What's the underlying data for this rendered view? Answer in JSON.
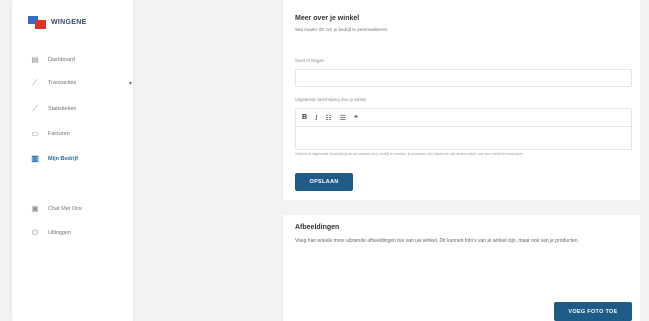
{
  "brand": {
    "name": "WINGENE"
  },
  "sidebar": {
    "items": [
      {
        "label": "Dashboard",
        "icon": "calendar-icon"
      },
      {
        "label": "Transacties",
        "icon": "chart-line-icon"
      },
      {
        "label": "Statistieken",
        "icon": "stats-icon"
      },
      {
        "label": "Facturen",
        "icon": "invoice-icon"
      },
      {
        "label": "Mijn Bedrijf",
        "icon": "store-icon"
      },
      {
        "label": "Chat Met Ons",
        "icon": "chat-icon"
      },
      {
        "label": "Uitloggen",
        "icon": "power-icon"
      }
    ]
  },
  "card1": {
    "title": "Meer over je winkel",
    "subtitle": "Wat maakt 'dit' om je bedrijf te personaliseren",
    "tags_label": "Soort of Slogan",
    "tags_value": "",
    "desc_label": "Uitgebreide beschrijving over je winkel",
    "toolbar": {
      "bold": "B",
      "italic": "I",
      "ul": "☷",
      "ol": "☰",
      "quote": "❝"
    },
    "help": "Gebruik de uitgebreide beschrijving om het verhaal van je bedrijf te vertellen, je producten of je klanten en alle andere zaken voor deze winkel te beschrijven.",
    "save_button": "OPSLAAN"
  },
  "card2": {
    "title": "Afbeeldingen",
    "body": "Voeg hier enkele mooi uitziende afbeeldingen toe van uw winkel. Dit kunnen foto's van je winkel zijn, maar ook van je producten.",
    "add_button": "VOEG FOTO TOE"
  },
  "colors": {
    "accent": "#1e5b86",
    "active_nav": "#1e6fa8",
    "logo_blue": "#2f6fc4",
    "logo_red": "#d9342b"
  }
}
